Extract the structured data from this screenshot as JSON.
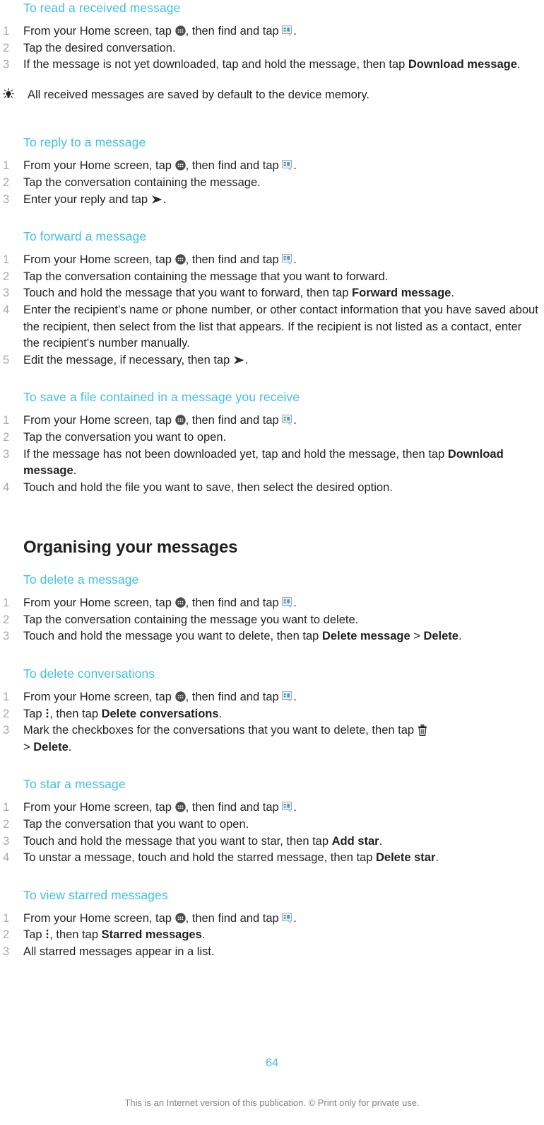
{
  "page": {
    "number": "64",
    "footer_note": "This is an Internet version of this publication. © Print only for private use.",
    "accent_color": "#41c0e3",
    "text_color": "#231f20",
    "number_color": "#a7a9ac",
    "footer_color": "#808285"
  },
  "icons": {
    "app_drawer": "app-drawer-icon",
    "messaging": "messaging-icon",
    "send": "send-icon",
    "overflow_menu": "overflow-menu-icon",
    "trash": "trash-icon",
    "tip_bulb": "lightbulb-tip-icon"
  },
  "sections": {
    "read_received": {
      "heading": "To read a received message",
      "steps": {
        "s1_a": "From your Home screen, tap ",
        "s1_b": ", then find and tap ",
        "s1_c": ".",
        "s2": "Tap the desired conversation.",
        "s3_a": "If the message is not yet downloaded, tap and hold the message, then tap ",
        "s3_bold": "Download message",
        "s3_c": "."
      },
      "tip": "All received messages are saved by default to the device memory."
    },
    "reply": {
      "heading": "To reply to a message",
      "steps": {
        "s1_a": "From your Home screen, tap ",
        "s1_b": ", then find and tap ",
        "s1_c": ".",
        "s2": "Tap the conversation containing the message.",
        "s3_a": "Enter your reply and tap ",
        "s3_c": "."
      }
    },
    "forward": {
      "heading": "To forward a message",
      "steps": {
        "s1_a": "From your Home screen, tap ",
        "s1_b": ", then find and tap ",
        "s1_c": ".",
        "s2": "Tap the conversation containing the message that you want to forward.",
        "s3_a": "Touch and hold the message that you want to forward, then tap ",
        "s3_bold": "Forward message",
        "s3_c": ".",
        "s4": "Enter the recipient’s name or phone number, or other contact information that you have saved about the recipient, then select from the list that appears. If the recipient is not listed as a contact, enter the recipient's number manually.",
        "s5_a": "Edit the message, if necessary, then tap ",
        "s5_c": "."
      }
    },
    "save_file": {
      "heading": "To save a file contained in a message you receive",
      "steps": {
        "s1_a": "From your Home screen, tap ",
        "s1_b": ", then find and tap ",
        "s1_c": ".",
        "s2": "Tap the conversation you want to open.",
        "s3_a": "If the message has not been downloaded yet, tap and hold the message, then tap ",
        "s3_bold": "Download message",
        "s3_c": ".",
        "s4": "Touch and hold the file you want to save, then select the desired option."
      }
    },
    "organising": {
      "heading": "Organising your messages"
    },
    "delete_message": {
      "heading": "To delete a message",
      "steps": {
        "s1_a": "From your Home screen, tap ",
        "s1_b": ", then find and tap ",
        "s1_c": ".",
        "s2": "Tap the conversation containing the message you want to delete.",
        "s3_a": "Touch and hold the message you want to delete, then tap ",
        "s3_bold": "Delete message",
        "s3_mid": " > ",
        "s3_bold2": "Delete",
        "s3_c": "."
      }
    },
    "delete_conversations": {
      "heading": "To delete conversations",
      "steps": {
        "s1_a": "From your Home screen, tap ",
        "s1_b": ", then find and tap ",
        "s1_c": ".",
        "s2_a": "Tap ",
        "s2_b": ", then tap ",
        "s2_bold": "Delete conversations",
        "s2_c": ".",
        "s3_a": "Mark the checkboxes for the conversations that you want to delete, then tap ",
        "s3_mid": " > ",
        "s3_bold": "Delete",
        "s3_c": "."
      }
    },
    "star_message": {
      "heading": "To star a message",
      "steps": {
        "s1_a": "From your Home screen, tap ",
        "s1_b": ", then find and tap ",
        "s1_c": ".",
        "s2": "Tap the conversation that you want to open.",
        "s3_a": "Touch and hold the message that you want to star, then tap ",
        "s3_bold": "Add star",
        "s3_c": ".",
        "s4_a": "To unstar a message, touch and hold the starred message, then tap ",
        "s4_bold": "Delete star",
        "s4_c": "."
      }
    },
    "view_starred": {
      "heading": "To view starred messages",
      "steps": {
        "s1_a": "From your Home screen, tap ",
        "s1_b": ", then find and tap ",
        "s1_c": ".",
        "s2_a": "Tap ",
        "s2_b": ", then tap ",
        "s2_bold": "Starred messages",
        "s2_c": ".",
        "s3": "All starred messages appear in a list."
      }
    }
  }
}
